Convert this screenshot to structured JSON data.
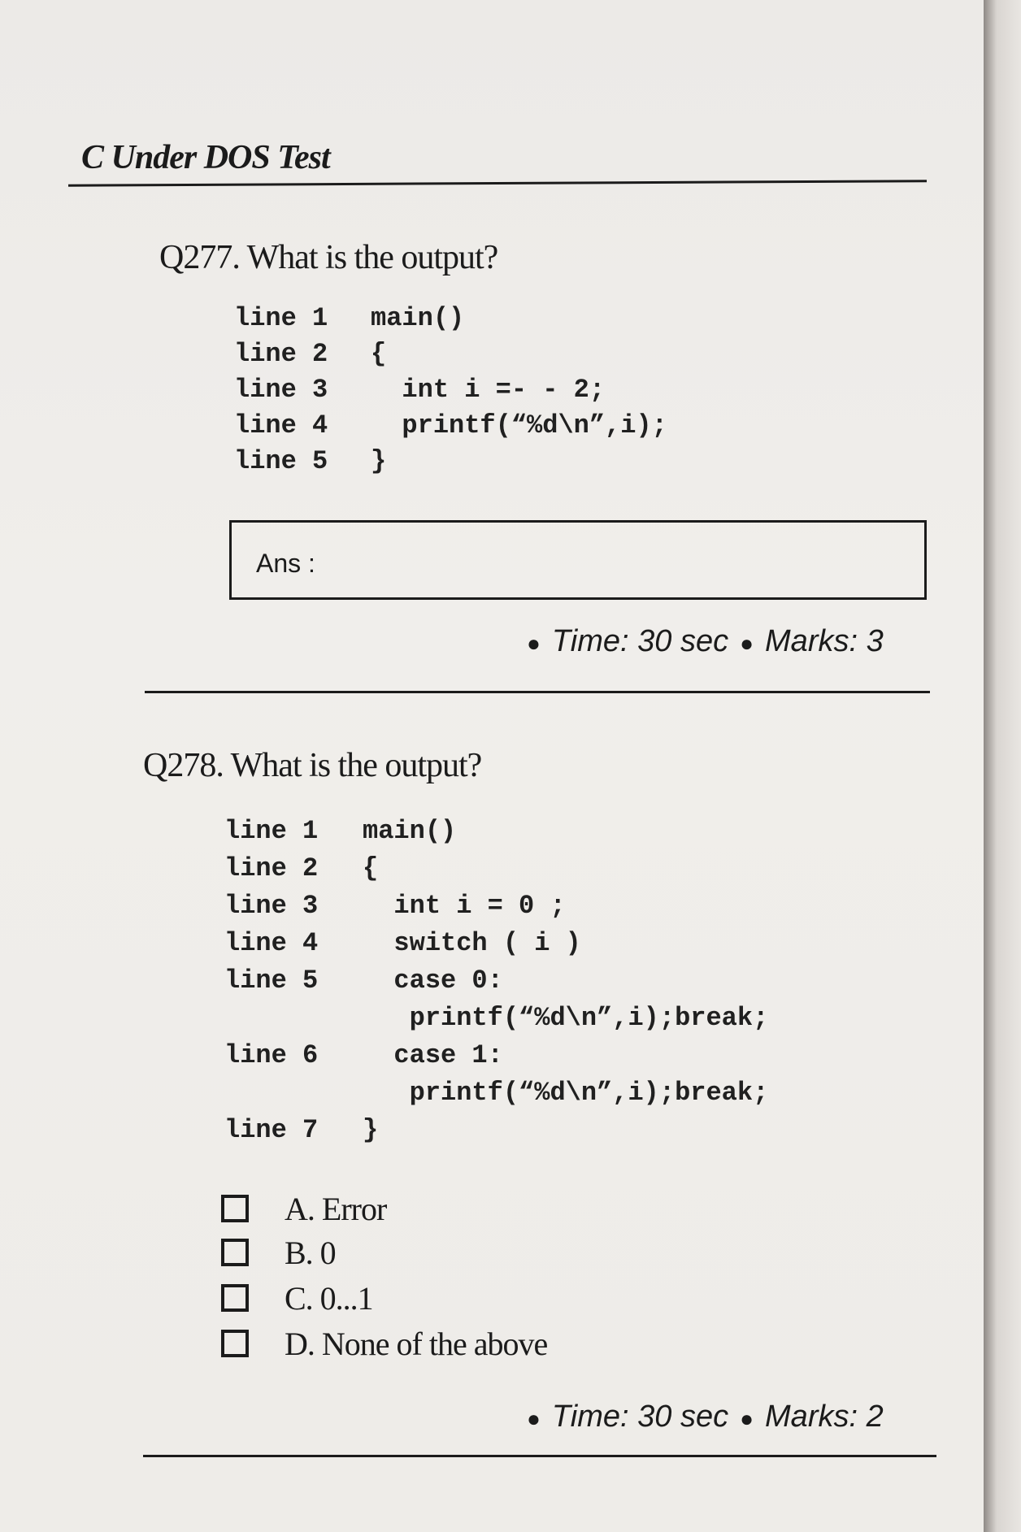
{
  "header": {
    "title": "C Under DOS Test"
  },
  "questions": [
    {
      "label": "Q277. What is the output?",
      "code": [
        {
          "line": "line 1",
          "text": "main()"
        },
        {
          "line": "line 2",
          "text": "{"
        },
        {
          "line": "line 3",
          "text": "  int i =- - 2;"
        },
        {
          "line": "line 4",
          "text": "  printf(“%d\\n”,i);"
        },
        {
          "line": "line 5",
          "text": "}"
        }
      ],
      "answer_label": "Ans :",
      "time": "Time: 30 sec",
      "marks": "Marks: 3"
    },
    {
      "label": "Q278. What is the output?",
      "code": [
        {
          "line": "line 1",
          "text": "main()"
        },
        {
          "line": "line 2",
          "text": "{"
        },
        {
          "line": "line 3",
          "text": "  int i = 0 ;"
        },
        {
          "line": "line 4",
          "text": "  switch ( i )"
        },
        {
          "line": "line 5",
          "text": "  case 0:"
        },
        {
          "line": "",
          "text": "   printf(“%d\\n”,i);break;"
        },
        {
          "line": "line 6",
          "text": "  case 1:"
        },
        {
          "line": "",
          "text": "   printf(“%d\\n”,i);break;"
        },
        {
          "line": "line 7",
          "text": "}"
        }
      ],
      "options": [
        "A. Error",
        "B. 0",
        "C. 0...1",
        "D. None of the above"
      ],
      "time": "Time: 30 sec",
      "marks": "Marks: 2"
    }
  ]
}
